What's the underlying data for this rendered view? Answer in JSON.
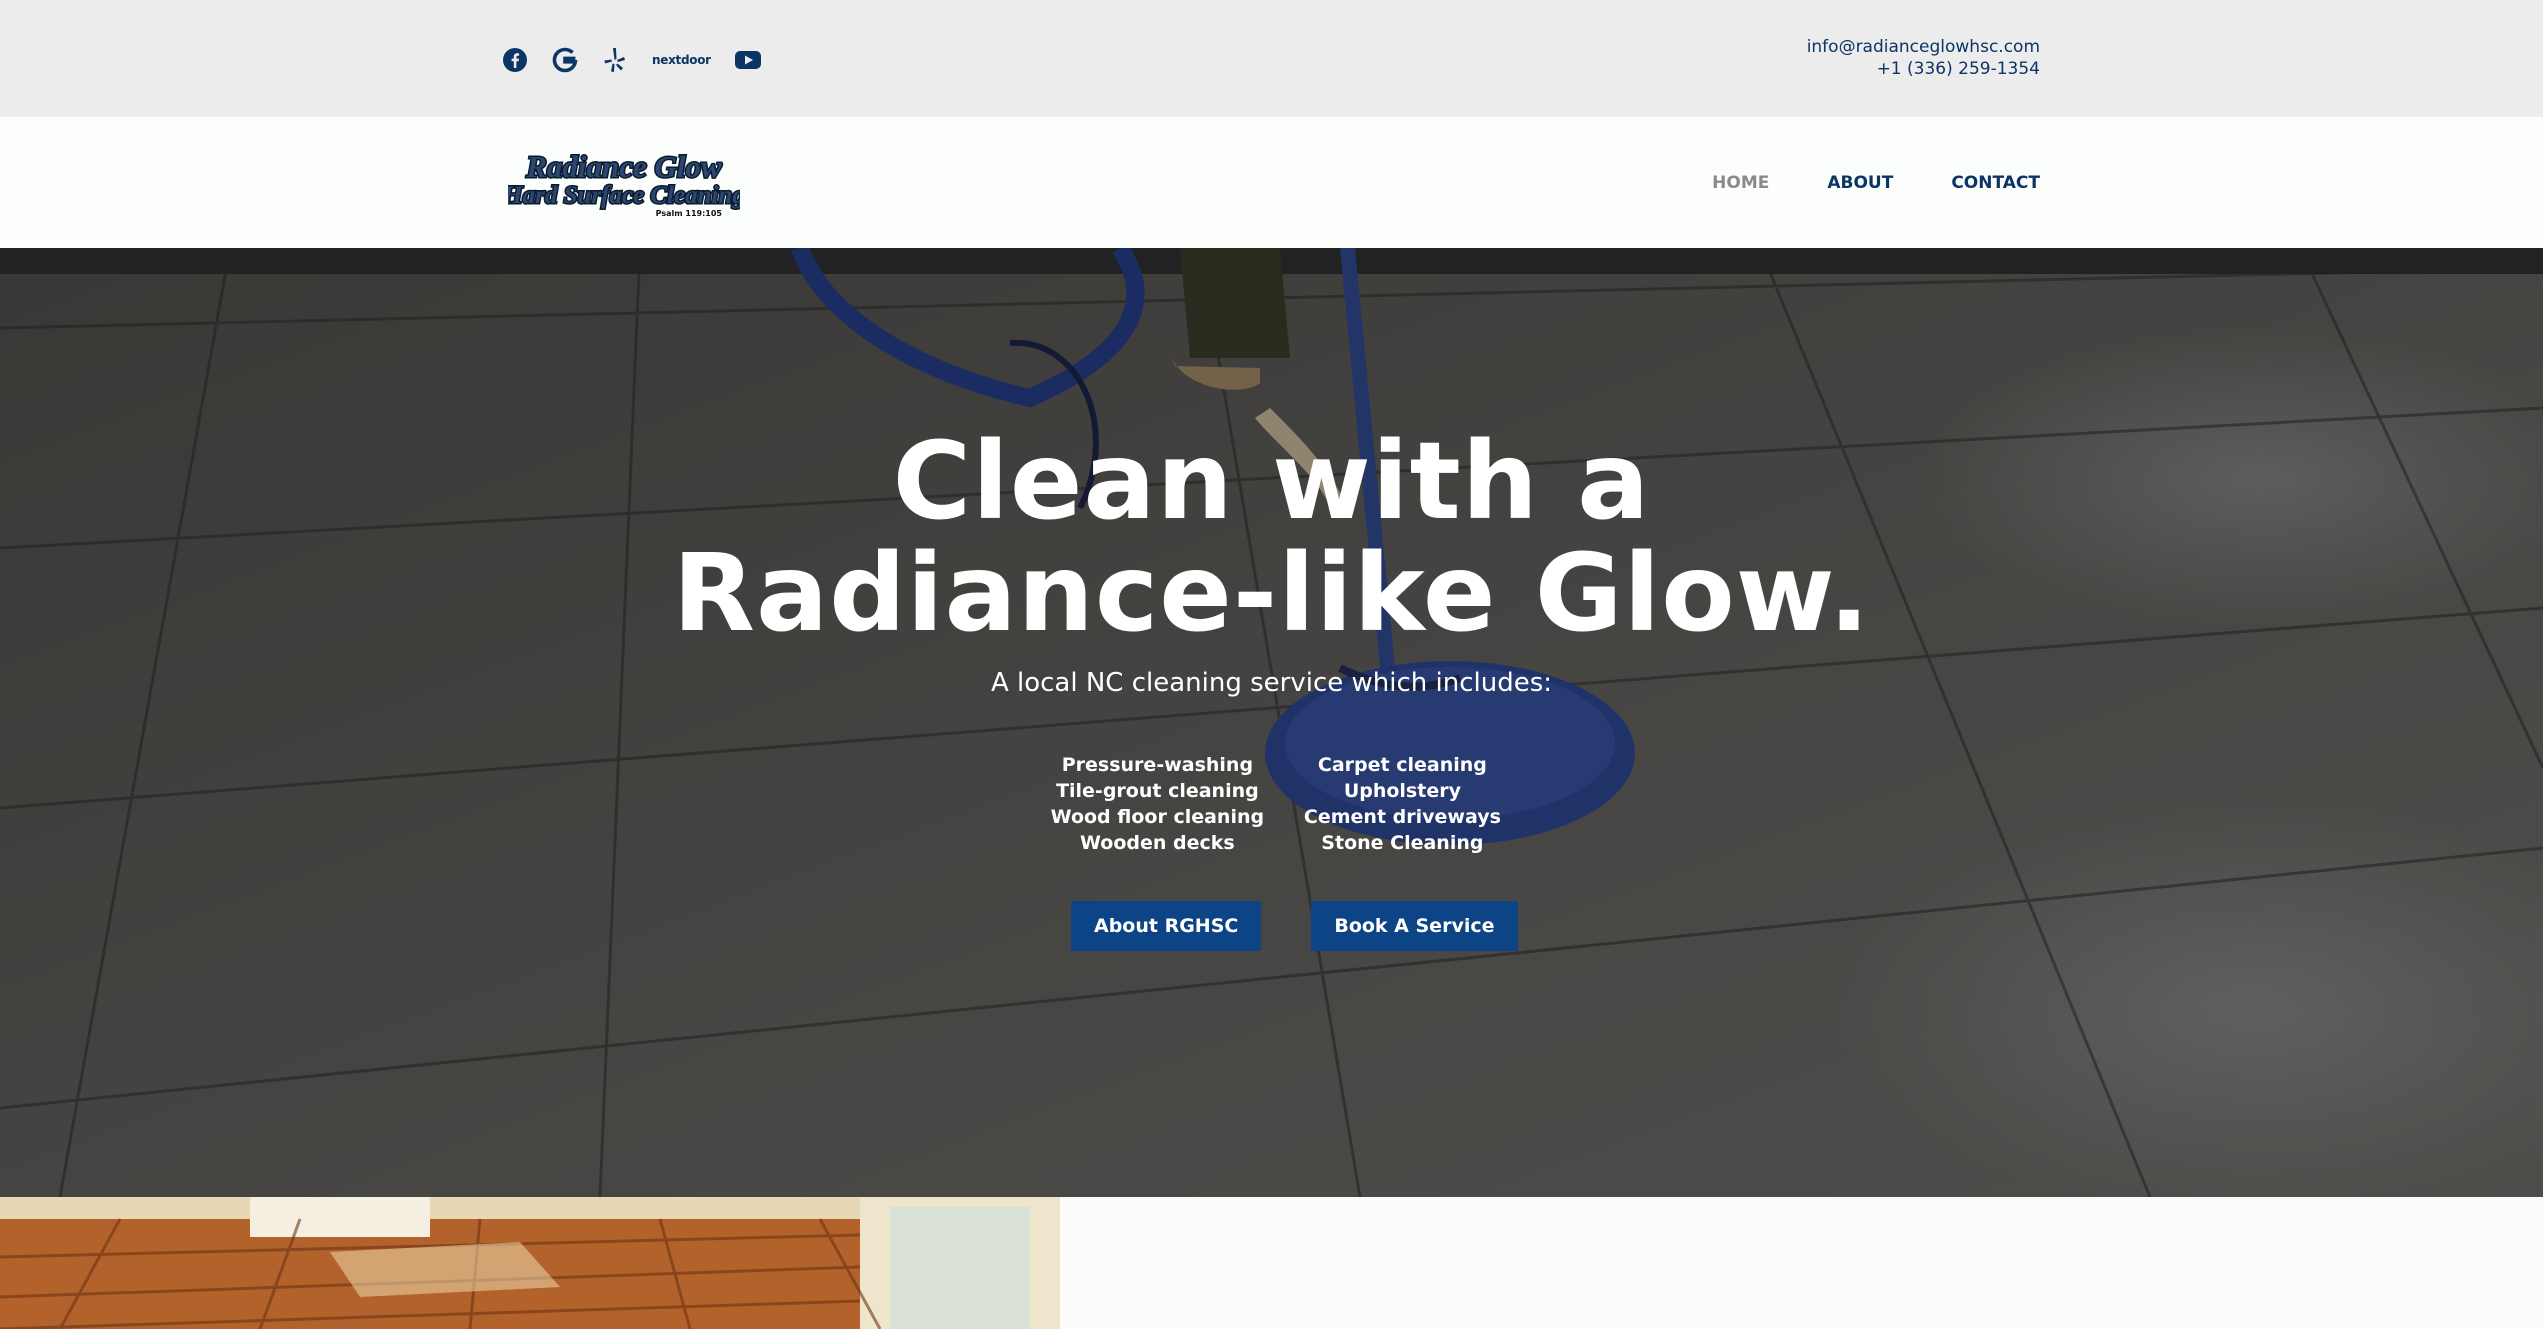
{
  "topbar": {
    "social": [
      {
        "name": "facebook-icon"
      },
      {
        "name": "google-icon"
      },
      {
        "name": "yelp-icon"
      },
      {
        "name": "nextdoor-icon",
        "label": "nextdoor"
      },
      {
        "name": "youtube-icon"
      }
    ],
    "email": "info@radianceglowhsc.com",
    "phone": "+1 (336) 259-1354"
  },
  "header": {
    "logo": {
      "line1": "Radiance Glow",
      "line2": "Hard Surface Cleaning",
      "line3": "Psalm 119:105"
    },
    "nav": {
      "home": "HOME",
      "about": "ABOUT",
      "contact": "CONTACT",
      "active": "HOME"
    }
  },
  "hero": {
    "title_line1": "Clean with a",
    "title_line2": "Radiance-like Glow.",
    "subtitle": "A local NC cleaning service which includes:",
    "services_left": [
      "Pressure-washing",
      "Tile-grout cleaning",
      "Wood floor cleaning",
      "Wooden decks"
    ],
    "services_right": [
      "Carpet cleaning",
      "Upholstery",
      "Cement driveways",
      "Stone Cleaning"
    ],
    "button_about": "About RGHSC",
    "button_book": "Book A Service"
  },
  "colors": {
    "brand_navy": "#0d3466",
    "button_blue": "#0d4486",
    "topbar_bg": "#ececec",
    "nav_active": "#8a8a8a"
  }
}
